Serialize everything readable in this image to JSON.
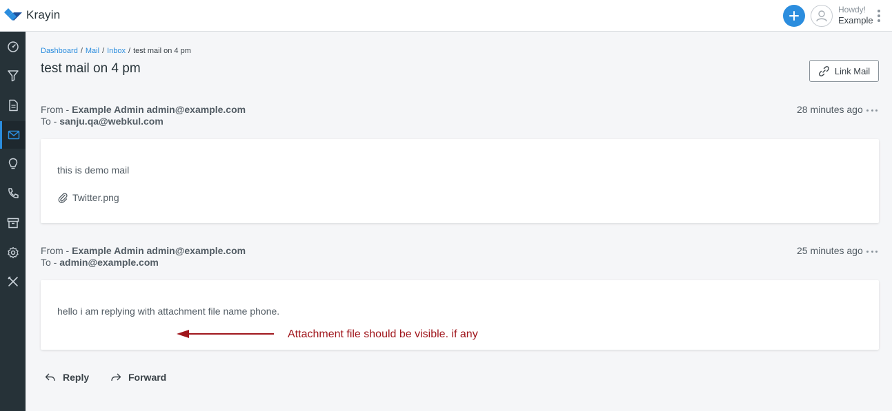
{
  "app": {
    "name": "Krayin"
  },
  "header": {
    "greeting": "Howdy!",
    "user_name": "Example",
    "add_label": "+"
  },
  "sidebar": {
    "items": [
      {
        "icon": "dashboard-icon"
      },
      {
        "icon": "filter-icon"
      },
      {
        "icon": "document-icon"
      },
      {
        "icon": "mail-icon",
        "active": true
      },
      {
        "icon": "lightbulb-icon"
      },
      {
        "icon": "phone-icon"
      },
      {
        "icon": "archive-icon"
      },
      {
        "icon": "settings-icon"
      },
      {
        "icon": "tools-icon"
      }
    ]
  },
  "breadcrumb": {
    "items": [
      "Dashboard",
      "Mail",
      "Inbox"
    ],
    "current": "test mail on 4 pm"
  },
  "page": {
    "title": "test mail on 4 pm",
    "link_mail_label": "Link Mail"
  },
  "emails": [
    {
      "from_prefix": "From - ",
      "from": "Example Admin admin@example.com",
      "to_prefix": "To - ",
      "to": "sanju.qa@webkul.com",
      "time": "28 minutes ago",
      "body": "this is demo mail",
      "attachment": "Twitter.png"
    },
    {
      "from_prefix": "From - ",
      "from": "Example Admin admin@example.com",
      "to_prefix": "To - ",
      "to": "admin@example.com",
      "time": "25 minutes ago",
      "body": "hello i am replying with attachment file name phone."
    }
  ],
  "annotation": {
    "text": "Attachment file should be visible. if any",
    "color": "#a0161c"
  },
  "actions": {
    "reply_label": "Reply",
    "forward_label": "Forward"
  },
  "colors": {
    "accent": "#2b8dde",
    "sidebar": "#263238"
  }
}
